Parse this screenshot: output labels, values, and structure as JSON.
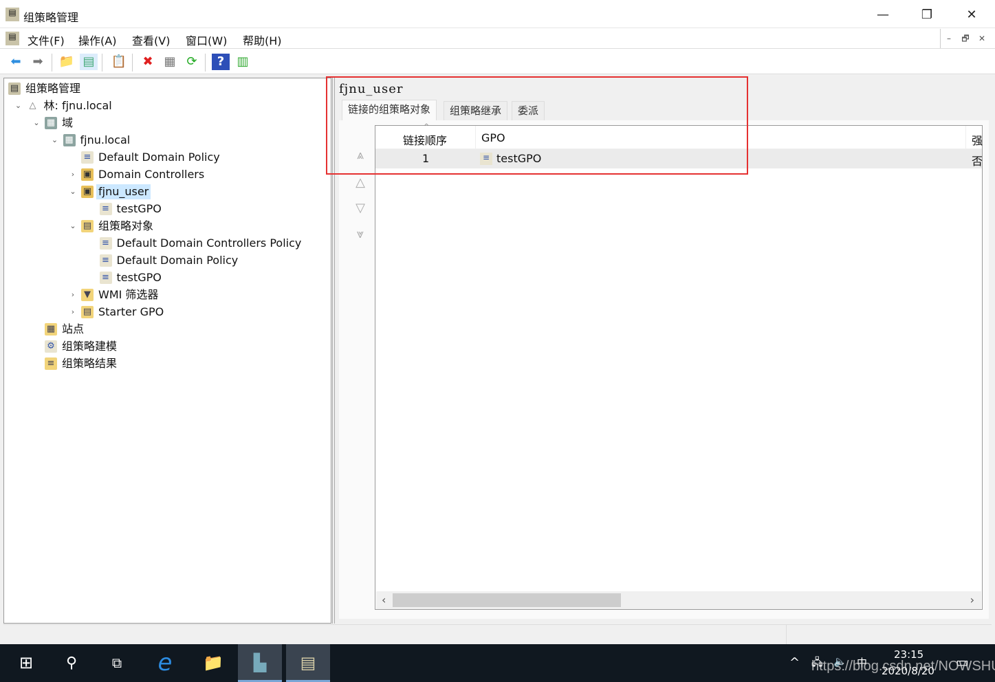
{
  "window": {
    "title": "组策略管理",
    "minimize": "—",
    "maximize": "❐",
    "close": "✕"
  },
  "menu": [
    "文件(F)",
    "操作(A)",
    "查看(V)",
    "窗口(W)",
    "帮助(H)"
  ],
  "mdi_controls": [
    "–",
    "🗗",
    "✕"
  ],
  "toolbar": [
    {
      "name": "back-icon",
      "glyph": "⬅",
      "color": "#2f8fe0"
    },
    {
      "name": "forward-icon",
      "glyph": "➡",
      "color": "#777"
    },
    {
      "name": "up-folder-icon",
      "glyph": "📁",
      "color": "#d4a92b"
    },
    {
      "name": "show-hide-tree-icon",
      "glyph": "▤",
      "color": "#4a7"
    },
    {
      "name": "clipboard-icon",
      "glyph": "📋",
      "color": "#555"
    },
    {
      "name": "delete-icon",
      "glyph": "✖",
      "color": "#e02020"
    },
    {
      "name": "properties-icon",
      "glyph": "▦",
      "color": "#777"
    },
    {
      "name": "refresh-icon",
      "glyph": "⟳",
      "color": "#2a2"
    },
    {
      "name": "help-icon",
      "glyph": "?",
      "color": "#fff"
    },
    {
      "name": "action-pane-icon",
      "glyph": "▥",
      "color": "#3a3"
    }
  ],
  "tree": [
    {
      "label": "组策略管理",
      "icon": "gpm",
      "glyph": "▤",
      "level": 0
    },
    {
      "label": "林: fjnu.local",
      "icon": "forest",
      "glyph": "△",
      "level": 1,
      "chevron": "⌄"
    },
    {
      "label": "域",
      "icon": "dom",
      "glyph": "▦",
      "level": 2,
      "chevron": "⌄"
    },
    {
      "label": "fjnu.local",
      "icon": "dom",
      "glyph": "▦",
      "level": 3,
      "chevron": "⌄"
    },
    {
      "label": "Default Domain Policy",
      "icon": "gpo",
      "glyph": "≡",
      "level": 4
    },
    {
      "label": "Domain Controllers",
      "icon": "ou",
      "glyph": "▣",
      "level": 4,
      "chevron": "›"
    },
    {
      "label": "fjnu_user",
      "icon": "ou",
      "glyph": "▣",
      "level": 4,
      "chevron": "⌄",
      "selected": true
    },
    {
      "label": "testGPO",
      "icon": "gpo",
      "glyph": "≡",
      "level": 5
    },
    {
      "label": "组策略对象",
      "icon": "fold",
      "glyph": "▤",
      "level": 4,
      "chevron": "⌄"
    },
    {
      "label": "Default Domain Controllers Policy",
      "icon": "gpo",
      "glyph": "≡",
      "level": 5
    },
    {
      "label": "Default Domain Policy",
      "icon": "gpo",
      "glyph": "≡",
      "level": 5
    },
    {
      "label": "testGPO",
      "icon": "gpo",
      "glyph": "≡",
      "level": 5
    },
    {
      "label": "WMI 筛选器",
      "icon": "fold",
      "glyph": "▼",
      "level": 4,
      "chevron": "›"
    },
    {
      "label": "Starter GPO",
      "icon": "fold",
      "glyph": "▤",
      "level": 4,
      "chevron": "›"
    },
    {
      "label": "站点",
      "icon": "fold",
      "glyph": "▦",
      "level": 2
    },
    {
      "label": "组策略建模",
      "icon": "gpo",
      "glyph": "⚙",
      "level": 2
    },
    {
      "label": "组策略结果",
      "icon": "fold",
      "glyph": "≡",
      "level": 2
    }
  ],
  "right": {
    "title": "fjnu_user",
    "tabs": [
      "链接的组策略对象",
      "组策略继承",
      "委派"
    ],
    "active_tab": 0,
    "columns": [
      "链接顺序",
      "GPO",
      "强"
    ],
    "sort_indicator": "^",
    "rows": [
      {
        "order": "1",
        "gpo": "testGPO",
        "enforced": "否"
      }
    ],
    "move_buttons": [
      {
        "name": "move-top-icon",
        "glyph": "⩓"
      },
      {
        "name": "move-up-icon",
        "glyph": "△"
      },
      {
        "name": "move-down-icon",
        "glyph": "▽"
      },
      {
        "name": "move-bottom-icon",
        "glyph": "⩔"
      }
    ],
    "scroll_left": "‹",
    "scroll_right": "›"
  },
  "taskbar": {
    "start": "⊞",
    "search": "⚲",
    "task_view": "⧉",
    "ie": "e",
    "explorer": "📁",
    "server_manager": "▙",
    "gpm": "▤",
    "tray_up": "^",
    "network": "🖧",
    "volume": "🔈",
    "ime": "中",
    "time": "23:15",
    "date": "2020/8/20",
    "notifications": "▭"
  },
  "watermark": "https://blog.csdn.net/NOWSHUT",
  "colors": {
    "highlight_box": "#e53030",
    "selection": "#cce8ff",
    "taskbar": "#101820"
  }
}
